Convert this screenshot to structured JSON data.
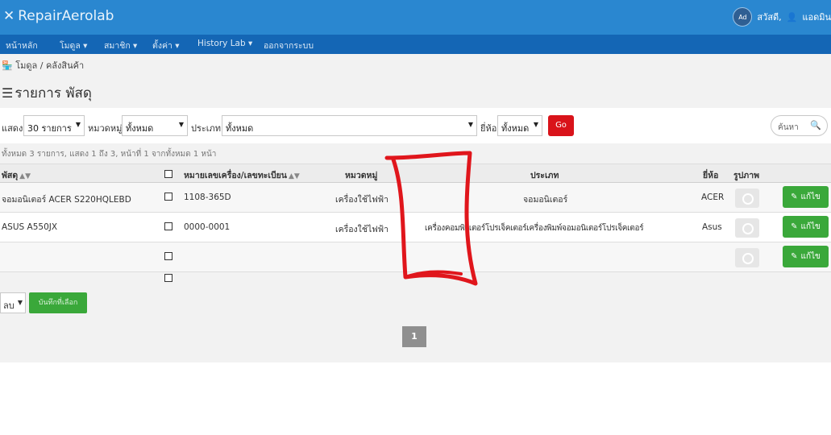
{
  "app": {
    "brand": "RepairAerolab",
    "user_prefix": "สวัสดี,",
    "user_name": "แอดมิน",
    "avatar_text": "Ad"
  },
  "nav": {
    "items": [
      "หน้าหลัก",
      "โมดูล ▾",
      "สมาชิก ▾",
      "ตั้งค่า ▾",
      "History Lab ▾",
      "ออกจากระบบ"
    ]
  },
  "breadcrumb": {
    "icon": "store-icon",
    "text": "โมดูล / คลังสินค้า"
  },
  "page": {
    "title": "รายการ พัสดุ"
  },
  "filters": {
    "show_label": "แสดง",
    "show_value": "30 รายการ",
    "category_label": "หมวดหมู่",
    "category_value": "ทั้งหมด",
    "type_label": "ประเภท",
    "type_value": "ทั้งหมด",
    "brand_label": "ยี่ห้อ",
    "brand_value": "ทั้งหมด",
    "go_label": "Go",
    "search_placeholder": "ค้นหา"
  },
  "summary": "ทั้งหมด 3 รายการ, แสดง 1 ถึง 3, หน้าที่ 1 จากทั้งหมด 1 หน้า",
  "table": {
    "headers": {
      "item": "พัสดุ",
      "serial": "หมายเลขเครื่อง/เลขทะเบียน",
      "category": "หมวดหมู่",
      "type": "ประเภท",
      "brand": "ยี่ห้อ",
      "image": "รูปภาพ"
    },
    "rows": [
      {
        "item": "จอมอนิเตอร์ ACER S220HQLEBD",
        "serial": "1108-365D",
        "category": "เครื่องใช้ไฟฟ้า",
        "type": "จอมอนิเตอร์",
        "brand": "ACER",
        "edit": "แก้ไข"
      },
      {
        "item": "ASUS A550JX",
        "serial": "0000-0001",
        "category": "เครื่องใช้ไฟฟ้า",
        "type": "เครื่องคอมพิวเตอร์โปรเจ็คเตอร์เครื่องพิมพ์จอมอนิเตอร์โปรเจ็คเตอร์",
        "brand": "Asus",
        "edit": "แก้ไข"
      },
      {
        "item": "",
        "serial": "",
        "category": "",
        "type": "",
        "brand": "",
        "edit": "แก้ไข"
      }
    ]
  },
  "bulk": {
    "action_value": "ลบ",
    "save_label": "บันทึกที่เลือก"
  },
  "pagination": {
    "current": "1"
  },
  "colors": {
    "topbar": "#2a87d0",
    "navbar": "#1466b5",
    "go": "#d9131a",
    "edit": "#3aa83a",
    "annotation": "#e0161c"
  }
}
